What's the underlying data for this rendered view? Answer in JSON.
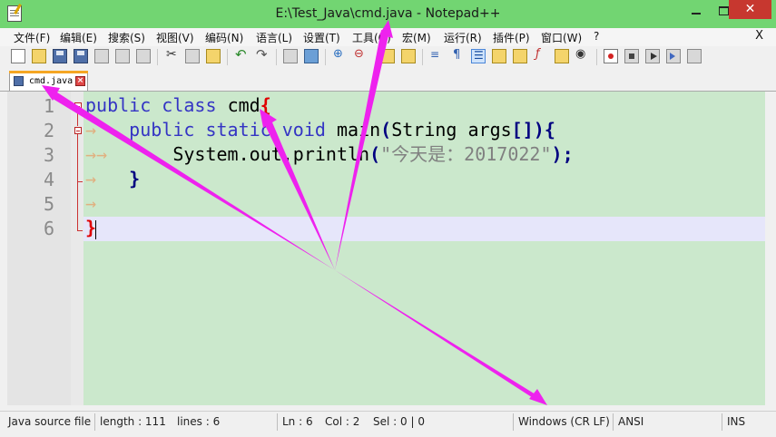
{
  "window": {
    "title": "E:\\Test_Java\\cmd.java - Notepad++",
    "close_glyph": "✕"
  },
  "menu": {
    "items": [
      "文件(F)",
      "编辑(E)",
      "搜索(S)",
      "视图(V)",
      "编码(N)",
      "语言(L)",
      "设置(T)",
      "工具(O)",
      "宏(M)",
      "运行(R)",
      "插件(P)",
      "窗口(W)",
      "?"
    ],
    "close_label": "X"
  },
  "tab": {
    "label": "cmd.java",
    "close_glyph": "×"
  },
  "editor": {
    "line_numbers": [
      "1",
      "2",
      "3",
      "4",
      "5",
      "6"
    ],
    "lines": [
      {
        "keyword1": "public",
        "keyword2": "class",
        "name": "cmd",
        "brace": "{"
      },
      {
        "indent": "→",
        "kw1": "public",
        "kw2": "static",
        "kw3": "void",
        "method": "main",
        "open": "(",
        "type": "String",
        "arg": "args",
        "brackets": "[]",
        "close": ")",
        "brace": "{"
      },
      {
        "indent": "→→",
        "call": "System.out.println",
        "open": "(",
        "string": "\"今天是：2017022\"",
        "close": ")",
        "semi": ";"
      },
      {
        "indent": "→",
        "brace": "}"
      },
      {
        "indent": "→"
      },
      {
        "brace": "}"
      }
    ]
  },
  "status": {
    "language": "Java source file",
    "length": "length : 111",
    "lines": "lines : 6",
    "ln": "Ln : 6",
    "col": "Col : 2",
    "sel": "Sel : 0 | 0",
    "eol": "Windows (CR LF)",
    "encoding": "ANSI",
    "mode": "INS"
  },
  "colors": {
    "titlebar": "#72d572",
    "editor_bg": "#cbe8cc",
    "keyword": "#3434c4",
    "annotation_arrow": "#ee22ee"
  }
}
